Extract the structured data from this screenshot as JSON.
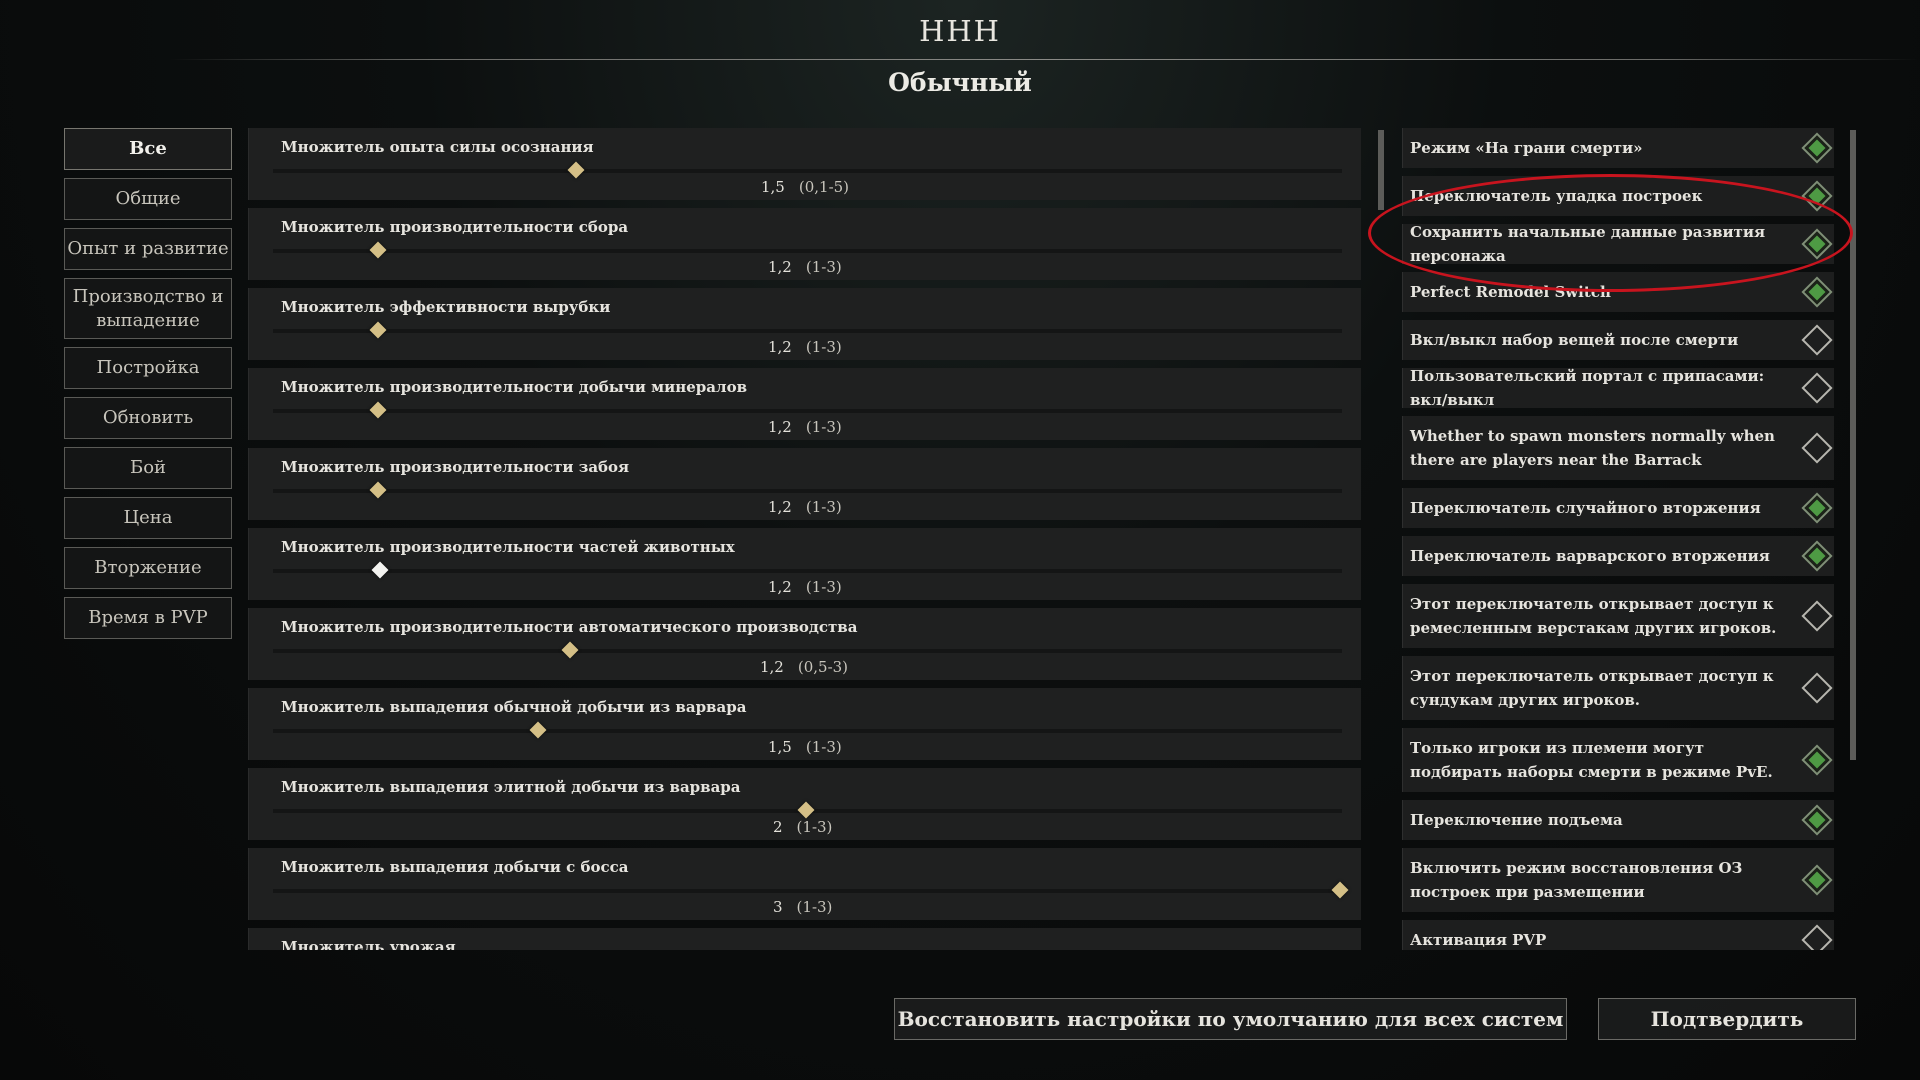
{
  "header": {
    "title": "ННН",
    "subtitle": "Обычный"
  },
  "categories": [
    {
      "label": "Все",
      "active": true
    },
    {
      "label": "Общие"
    },
    {
      "label": "Опыт и развитие"
    },
    {
      "label": "Производство и выпадение"
    },
    {
      "label": "Постройка"
    },
    {
      "label": "Обновить"
    },
    {
      "label": "Бой"
    },
    {
      "label": "Цена"
    },
    {
      "label": "Вторжение"
    },
    {
      "label": "Время в PVP"
    }
  ],
  "sliders": [
    {
      "label": "Множитель опыта силы осознания",
      "value": "1,5",
      "range": "(0,1-5)"
    },
    {
      "label": "Множитель производительности сбора",
      "value": "1,2",
      "range": "(1-3)"
    },
    {
      "label": "Множитель эффективности вырубки",
      "value": "1,2",
      "range": "(1-3)"
    },
    {
      "label": "Множитель производительности добычи минералов",
      "value": "1,2",
      "range": "(1-3)"
    },
    {
      "label": "Множитель производительности забоя",
      "value": "1,2",
      "range": "(1-3)"
    },
    {
      "label": "Множитель производительности частей животных",
      "value": "1,2",
      "range": "(1-3)"
    },
    {
      "label": "Множитель производительности автоматического производства",
      "value": "1,2",
      "range": "(0,5-3)"
    },
    {
      "label": "Множитель выпадения обычной добычи из варвара",
      "value": "1,5",
      "range": "(1-3)"
    },
    {
      "label": "Множитель выпадения элитной добычи из варвара",
      "value": "2",
      "range": "(1-3)"
    },
    {
      "label": "Множитель выпадения добычи с босса",
      "value": "3",
      "range": "(1-3)"
    },
    {
      "label": "Множитель урожая",
      "value": "",
      "range": ""
    }
  ],
  "toggles": [
    {
      "label": "Режим «На грани смерти»",
      "on": true
    },
    {
      "label": "Переключатель упадка построек",
      "on": true
    },
    {
      "label": "Сохранить начальные данные развития персонажа",
      "on": true
    },
    {
      "label": "Perfect Remodel Switch",
      "on": true
    },
    {
      "label": "Вкл/выкл набор вещей после смерти",
      "on": false
    },
    {
      "label": "Пользовательский портал с припасами: вкл/выкл",
      "on": false
    },
    {
      "label": "Whether to spawn monsters normally when there are players near the Barrack",
      "on": false
    },
    {
      "label": "Переключатель случайного вторжения",
      "on": true
    },
    {
      "label": "Переключатель варварского вторжения",
      "on": true
    },
    {
      "label": "Этот переключатель открывает доступ к ремесленным верстакам других игроков.",
      "on": false
    },
    {
      "label": "Этот переключатель открывает доступ к сундукам других игроков.",
      "on": false
    },
    {
      "label": "Только игроки из племени могут подбирать наборы смерти в режиме PvE.",
      "on": true
    },
    {
      "label": "Переключение подъема",
      "on": true
    },
    {
      "label": "Включить режим восстановления ОЗ построек при размещении",
      "on": true
    },
    {
      "label": "Активация PVP",
      "on": false
    }
  ],
  "footer": {
    "reset_label": "Восстановить настройки по умолчанию для всех систем",
    "confirm_label": "Подтвердить"
  },
  "colors": {
    "toggle_on": "#4e9a44",
    "slider_knob": "#d4bf86",
    "annotation": "#c8141e"
  }
}
